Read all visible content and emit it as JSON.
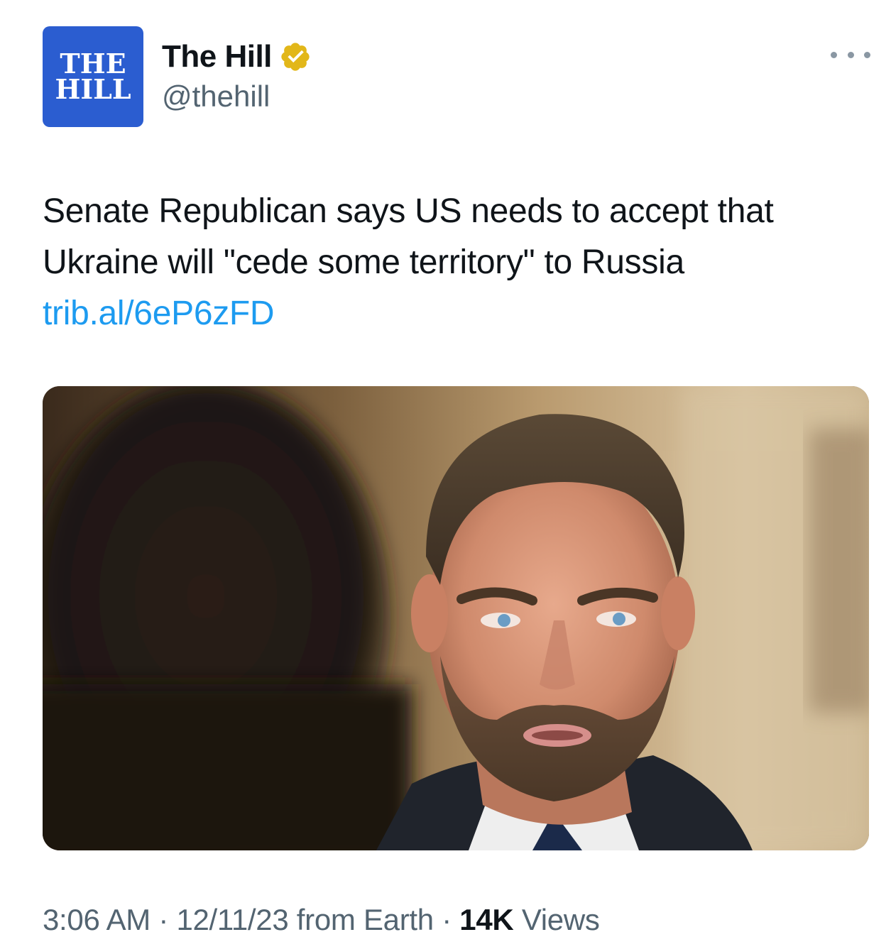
{
  "author": {
    "avatar_line1": "THE",
    "avatar_line2": "HILL",
    "display_name": "The Hill",
    "handle": "@thehill",
    "verified_badge": "gold-verified-badge-icon"
  },
  "tweet": {
    "text": "Senate Republican says US needs to accept that Ukraine will \"cede some territory\" to Russia",
    "link": "trib.al/6eP6zFD"
  },
  "meta": {
    "time": "3:06 AM",
    "separator1": " · ",
    "date": "12/11/23",
    "source": " from Earth",
    "separator2": " · ",
    "views_count": "14K",
    "views_label": " Views"
  },
  "icons": {
    "more": "more-horizontal-icon"
  },
  "colors": {
    "accent": "#1d9bf0",
    "secondary_text": "#536471",
    "avatar_bg": "#2b5dd0",
    "verified_gold": "#e2b719"
  }
}
